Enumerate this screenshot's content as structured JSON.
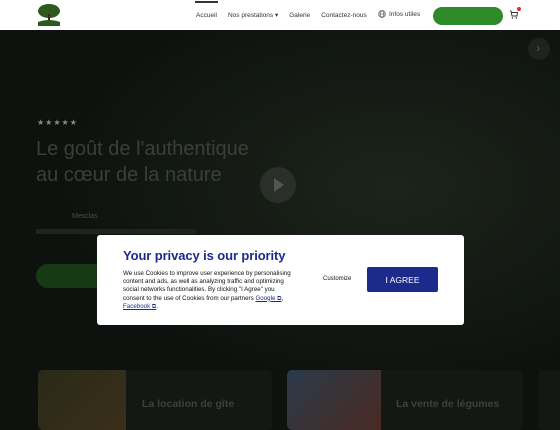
{
  "header": {
    "logo_icon": "tree-logo-icon",
    "nav": [
      {
        "label": "Accueil",
        "active": true
      },
      {
        "label": "Nos prestations",
        "has_dropdown": true
      },
      {
        "label": "Galerie"
      },
      {
        "label": "Contactez-nous"
      }
    ],
    "infos_label": "Infos utiles",
    "infos_icon": "globe-icon",
    "cart_icon": "cart-icon"
  },
  "hero": {
    "stars": "★★★★★",
    "title_line1": "Le goût de l'authentique",
    "title_line2": "au cœur de la nature",
    "subtitle": "Mesclas",
    "play_icon": "play-icon",
    "next_icon": "chevron-right-icon"
  },
  "cards": [
    {
      "label": "La location de gîte"
    },
    {
      "label": "La vente de légumes"
    }
  ],
  "cookie_modal": {
    "title": "Your privacy is our priority",
    "body_text": "We use Cookies to improve user experience by personalising content and ads, as well as analyzing traffic and optimizing social networks functionalities. By clicking \"I Agree\" you consent to the use of Cookies from our partners",
    "link_google": "Google",
    "link_facebook": "Facebook",
    "customize_label": "Customize",
    "agree_label": "I AGREE"
  },
  "colors": {
    "brand_blue": "#1c2a8c",
    "brand_green": "#2f8a2a"
  }
}
